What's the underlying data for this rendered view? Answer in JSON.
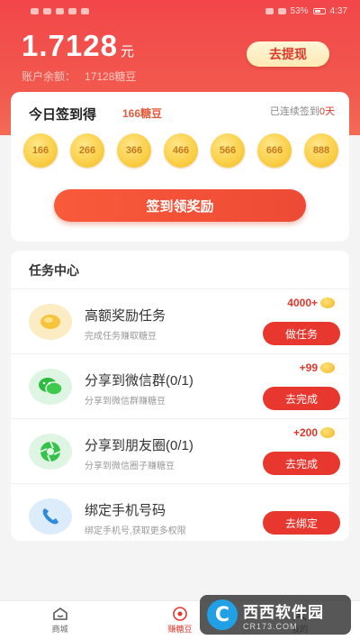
{
  "status_bar": {
    "battery": "53%",
    "time": "4:37"
  },
  "header": {
    "balance": "1.7128",
    "unit": "元",
    "account_label": "账户余额：",
    "account_value": "17128糖豆",
    "withdraw_label": "去提现"
  },
  "signin": {
    "title": "今日签到得",
    "reward": "166糖豆",
    "streak_prefix": "已连续签到",
    "streak_value": "0天",
    "coins": [
      "166",
      "266",
      "366",
      "466",
      "566",
      "666",
      "888"
    ],
    "button_label": "签到领奖励"
  },
  "tasks": {
    "header": "任务中心",
    "items": [
      {
        "title": "高额奖励任务",
        "desc": "完成任务赚取糖豆",
        "reward": "4000+",
        "button": "做任务",
        "icon": "coin-icon"
      },
      {
        "title": "分享到微信群(0/1)",
        "desc": "分享到微信群赚糖豆",
        "reward": "+99",
        "button": "去完成",
        "icon": "wechat-icon"
      },
      {
        "title": "分享到朋友圈(0/1)",
        "desc": "分享到微信圈子赚糖豆",
        "reward": "+200",
        "button": "去完成",
        "icon": "moments-icon"
      },
      {
        "title": "绑定手机号码",
        "desc": "绑定手机号,获取更多权限",
        "reward": "",
        "button": "去绑定",
        "icon": "phone-icon"
      }
    ]
  },
  "tabbar": {
    "items": [
      {
        "label": "商城",
        "icon": "home-icon"
      },
      {
        "label": "赚糖豆",
        "icon": "earn-icon"
      },
      {
        "label": "我的",
        "icon": "profile-icon"
      }
    ]
  },
  "watermark": {
    "main": "西西软件园",
    "sub": "CR173.COM",
    "logo": "C"
  },
  "colors": {
    "primary_red": "#e8372f",
    "header_gradient": "#f2464a",
    "coin_gold": "#fbd04a"
  }
}
